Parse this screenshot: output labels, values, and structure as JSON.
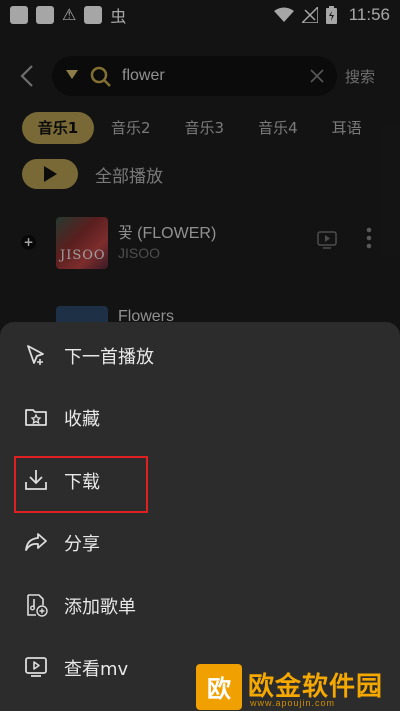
{
  "status_bar": {
    "time": "11:56"
  },
  "search": {
    "query": "flower",
    "button_label": "搜索"
  },
  "tabs": [
    {
      "label": "音乐1"
    },
    {
      "label": "音乐2"
    },
    {
      "label": "音乐3"
    },
    {
      "label": "音乐4"
    },
    {
      "label": "耳语"
    }
  ],
  "play_all": {
    "label": "全部播放"
  },
  "songs": [
    {
      "title": "꽃 (FLOWER)",
      "artist": "JISOO",
      "cover_text": "JISOO"
    },
    {
      "title": "Flowers",
      "artist": ""
    }
  ],
  "menu": [
    {
      "label": "下一首播放",
      "icon": "play-next-icon"
    },
    {
      "label": "收藏",
      "icon": "folder-star-icon"
    },
    {
      "label": "下载",
      "icon": "download-icon"
    },
    {
      "label": "分享",
      "icon": "share-icon"
    },
    {
      "label": "添加歌单",
      "icon": "add-playlist-icon"
    },
    {
      "label": "查看mv",
      "icon": "mv-icon"
    }
  ],
  "watermark": {
    "logo_text": "欧",
    "text": "欧金软件园",
    "url": "www.apoujin.com"
  },
  "colors": {
    "accent": "#b8a254",
    "highlight_border": "#e02020",
    "sheet_bg": "#2c2c2c"
  }
}
